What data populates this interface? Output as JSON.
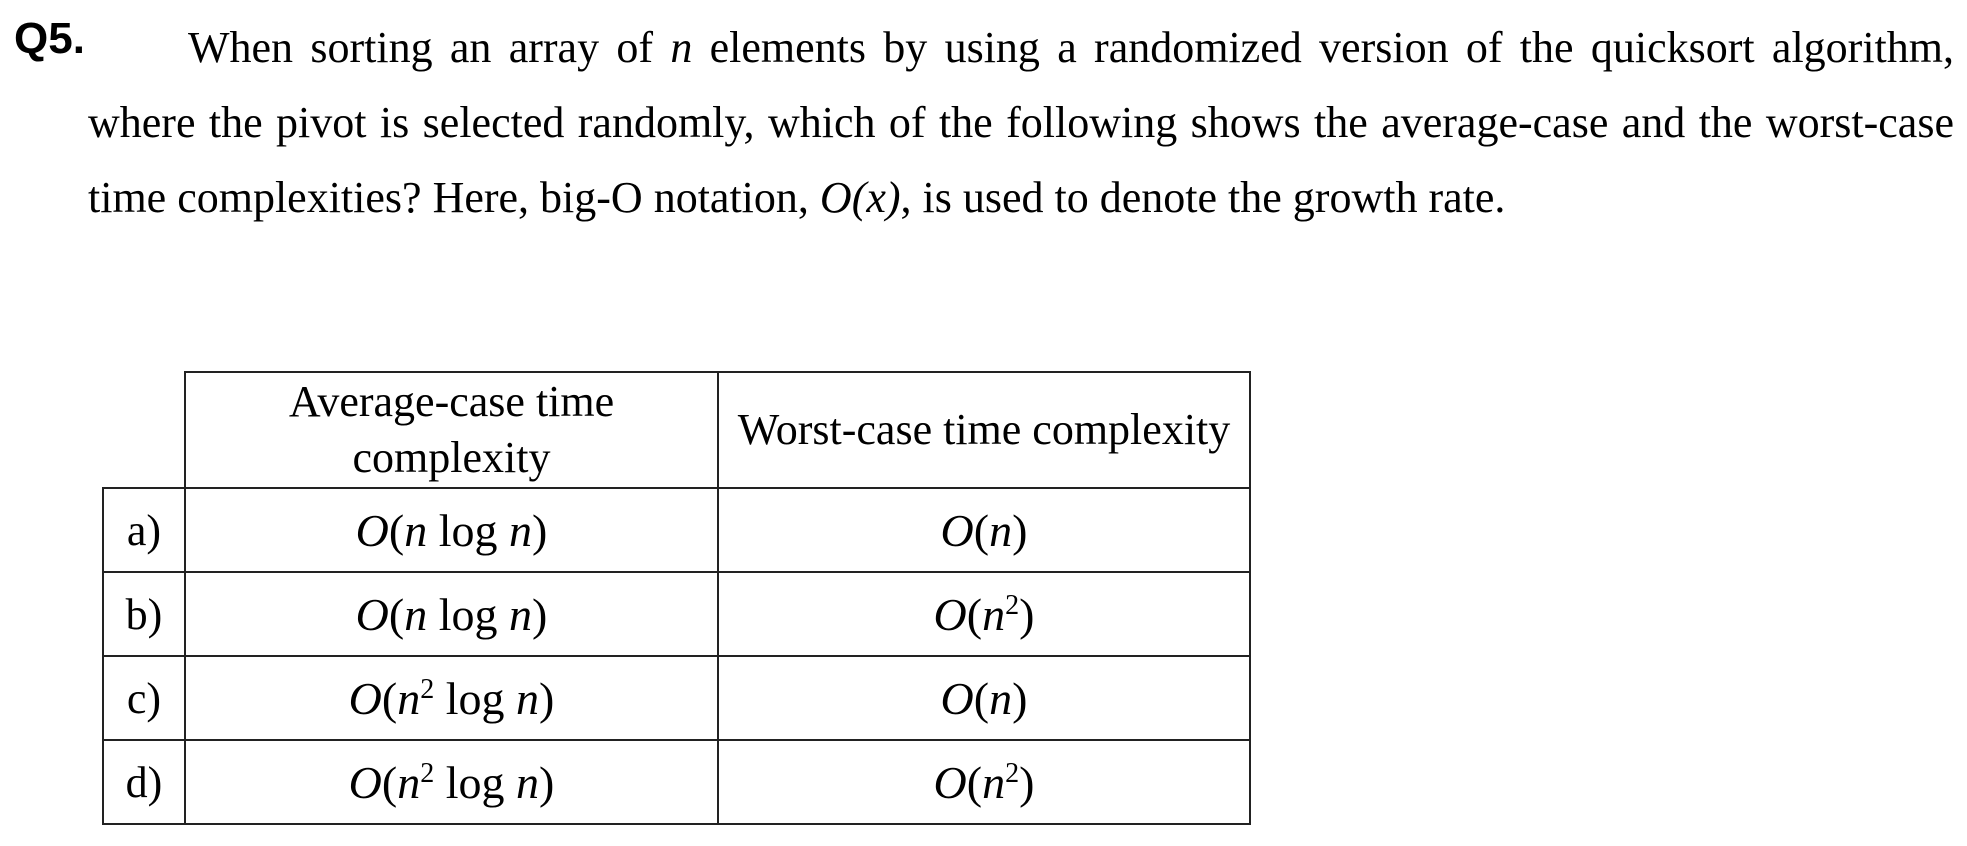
{
  "question": {
    "number": "Q5.",
    "text_1": "When sorting an array of ",
    "var_n": "n",
    "text_2": " elements by using a randomized version of the quicksort algorithm, where the pivot is selected randomly, which of the following shows the average-case and the worst-case time complexities? Here, big-O notation, ",
    "notation": "O(x)",
    "text_3": ", is used to denote the growth rate."
  },
  "table": {
    "headers": {
      "average": "Average-case time complexity",
      "worst": "Worst-case time complexity"
    },
    "rows": [
      {
        "label": "a)",
        "average": "O(n log n)",
        "worst": "O(n)"
      },
      {
        "label": "b)",
        "average": "O(n log n)",
        "worst": "O(n²)"
      },
      {
        "label": "c)",
        "average": "O(n² log n)",
        "worst": "O(n)"
      },
      {
        "label": "d)",
        "average": "O(n² log n)",
        "worst": "O(n²)"
      }
    ]
  }
}
